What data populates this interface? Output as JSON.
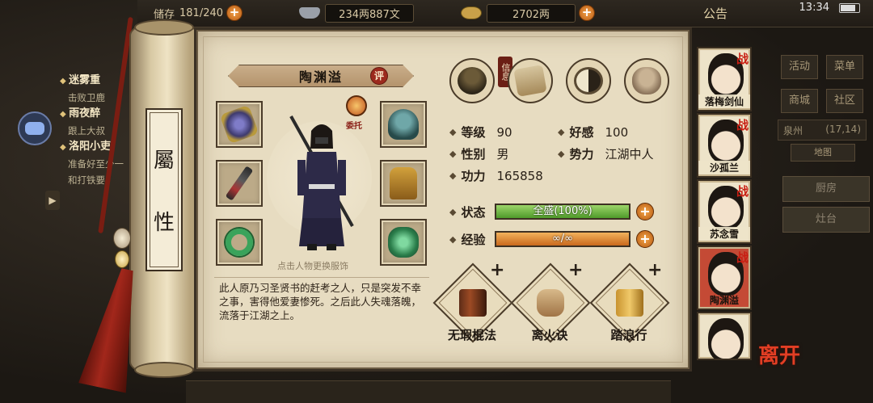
{
  "topbar": {
    "capacity_label": "储存",
    "capacity": "181/240",
    "copper": "234两887文",
    "silver": "2702两",
    "notice": "公告"
  },
  "status": {
    "time": "13:34"
  },
  "quests": [
    {
      "title": "迷雾重",
      "desc": "击败卫鹿"
    },
    {
      "title": "雨夜醉",
      "desc": "跟上大叔"
    },
    {
      "title": "洛阳小吏",
      "desc": "准备好至少一\n和打铁要"
    }
  ],
  "right_menu": {
    "activity": "活动",
    "menu": "菜单",
    "shop": "商城",
    "community": "社区",
    "location": "泉州",
    "coords": "(17,14)",
    "tag": "地图",
    "kitchen": "厨房",
    "stove": "灶台"
  },
  "scroll_tab": {
    "char1": "屬",
    "char2": "性"
  },
  "hero": {
    "name": "陶渊溢",
    "rate_label": "评",
    "delegate_label": "委托",
    "change_outfit_hint": "点击人物更换服饰",
    "bio": "此人原乃习圣贤书的赶考之人，只是突发不幸之事，害得他爱妻惨死。之后此人失魂落魄，流落于江湖之上。"
  },
  "tab_tag": "信息",
  "stats": {
    "level_label": "等级",
    "level": "90",
    "favor_label": "好感",
    "favor": "100",
    "gender_label": "性别",
    "gender": "男",
    "faction_label": "势力",
    "faction": "江湖中人",
    "power_label": "功力",
    "power": "165858"
  },
  "bars": {
    "state_label": "状态",
    "state_text": "全盛(100%)",
    "state_fill": 1.0,
    "exp_label": "经验",
    "exp_text": "∞/∞",
    "exp_fill": 1.0,
    "plus": "+"
  },
  "skills": [
    {
      "name": "无瑕棍法",
      "icon": "book-icon"
    },
    {
      "name": "离火诀",
      "icon": "scroll-icon"
    },
    {
      "name": "踏浪行",
      "icon": "manual-icon"
    }
  ],
  "companions": [
    {
      "name": "落梅剑仙",
      "battle": "战"
    },
    {
      "name": "沙孤兰",
      "battle": "战"
    },
    {
      "name": "苏念雪",
      "battle": "战"
    },
    {
      "name": "陶渊溢",
      "battle": "战"
    },
    {
      "name": "",
      "battle": ""
    }
  ],
  "leave_label": "离开",
  "colors": {
    "accent": "#c44a35",
    "panel": "#e7dcc1",
    "state_bar": "#4f9a2a",
    "exp_bar": "#c9691d"
  }
}
